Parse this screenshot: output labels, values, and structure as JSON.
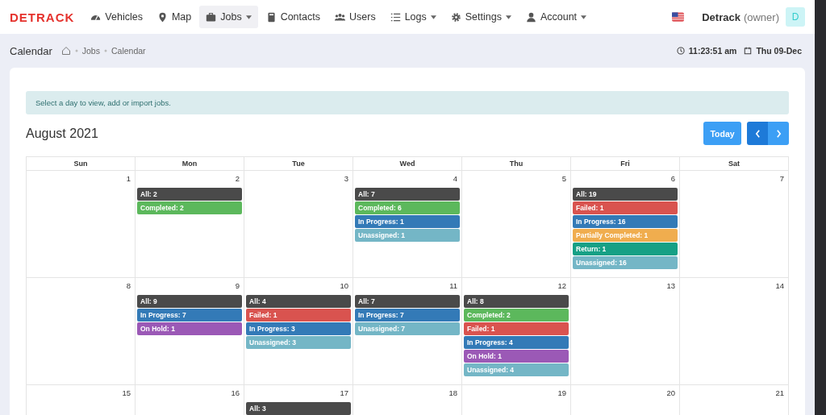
{
  "brand": {
    "logo": "DETRACK"
  },
  "nav": [
    {
      "label": "Vehicles",
      "dropdown": false,
      "selected": false
    },
    {
      "label": "Map",
      "dropdown": false,
      "selected": false
    },
    {
      "label": "Jobs",
      "dropdown": true,
      "selected": true
    },
    {
      "label": "Contacts",
      "dropdown": false,
      "selected": false
    },
    {
      "label": "Users",
      "dropdown": false,
      "selected": false
    },
    {
      "label": "Logs",
      "dropdown": true,
      "selected": false
    },
    {
      "label": "Settings",
      "dropdown": true,
      "selected": false
    },
    {
      "label": "Account",
      "dropdown": true,
      "selected": false
    }
  ],
  "user": {
    "name": "Detrack",
    "role": "(owner)",
    "avatar": "D"
  },
  "page": {
    "title": "Calendar",
    "breadcrumbs": [
      "Jobs",
      "Calendar"
    ],
    "time": "11:23:51 am",
    "date": "Thu 09-Dec"
  },
  "alert": "Select a day to view, add or import jobs.",
  "calendar": {
    "month": "August 2021",
    "today_button": "Today",
    "weekdays": [
      "Sun",
      "Mon",
      "Tue",
      "Wed",
      "Thu",
      "Fri",
      "Sat"
    ],
    "weeks": [
      [
        {
          "day": "1"
        },
        {
          "day": "2",
          "events": [
            {
              "label": "All: 2",
              "color": "#4a4a4a"
            },
            {
              "label": "Completed: 2",
              "color": "#5cb85c"
            }
          ]
        },
        {
          "day": "3"
        },
        {
          "day": "4",
          "events": [
            {
              "label": "All: 7",
              "color": "#4a4a4a"
            },
            {
              "label": "Completed: 6",
              "color": "#5cb85c"
            },
            {
              "label": "In Progress: 1",
              "color": "#337ab7"
            },
            {
              "label": "Unassigned: 1",
              "color": "#74b6c6"
            }
          ]
        },
        {
          "day": "5"
        },
        {
          "day": "6",
          "events": [
            {
              "label": "All: 19",
              "color": "#4a4a4a"
            },
            {
              "label": "Failed: 1",
              "color": "#d9534f"
            },
            {
              "label": "In Progress: 16",
              "color": "#337ab7"
            },
            {
              "label": "Partially Completed: 1",
              "color": "#f0ad4e"
            },
            {
              "label": "Return: 1",
              "color": "#16a085"
            },
            {
              "label": "Unassigned: 16",
              "color": "#74b6c6"
            }
          ]
        },
        {
          "day": "7"
        }
      ],
      [
        {
          "day": "8"
        },
        {
          "day": "9",
          "events": [
            {
              "label": "All: 9",
              "color": "#4a4a4a"
            },
            {
              "label": "In Progress: 7",
              "color": "#337ab7"
            },
            {
              "label": "On Hold: 1",
              "color": "#9b59b6"
            }
          ]
        },
        {
          "day": "10",
          "events": [
            {
              "label": "All: 4",
              "color": "#4a4a4a"
            },
            {
              "label": "Failed: 1",
              "color": "#d9534f"
            },
            {
              "label": "In Progress: 3",
              "color": "#337ab7"
            },
            {
              "label": "Unassigned: 3",
              "color": "#74b6c6"
            }
          ]
        },
        {
          "day": "11",
          "events": [
            {
              "label": "All: 7",
              "color": "#4a4a4a"
            },
            {
              "label": "In Progress: 7",
              "color": "#337ab7"
            },
            {
              "label": "Unassigned: 7",
              "color": "#74b6c6"
            }
          ]
        },
        {
          "day": "12",
          "events": [
            {
              "label": "All: 8",
              "color": "#4a4a4a"
            },
            {
              "label": "Completed: 2",
              "color": "#5cb85c"
            },
            {
              "label": "Failed: 1",
              "color": "#d9534f"
            },
            {
              "label": "In Progress: 4",
              "color": "#337ab7"
            },
            {
              "label": "On Hold: 1",
              "color": "#9b59b6"
            },
            {
              "label": "Unassigned: 4",
              "color": "#74b6c6"
            }
          ]
        },
        {
          "day": "13"
        },
        {
          "day": "14"
        }
      ],
      [
        {
          "day": "15"
        },
        {
          "day": "16"
        },
        {
          "day": "17",
          "events": [
            {
              "label": "All: 3",
              "color": "#4a4a4a"
            }
          ]
        },
        {
          "day": "18"
        },
        {
          "day": "19"
        },
        {
          "day": "20"
        },
        {
          "day": "21"
        }
      ]
    ]
  }
}
